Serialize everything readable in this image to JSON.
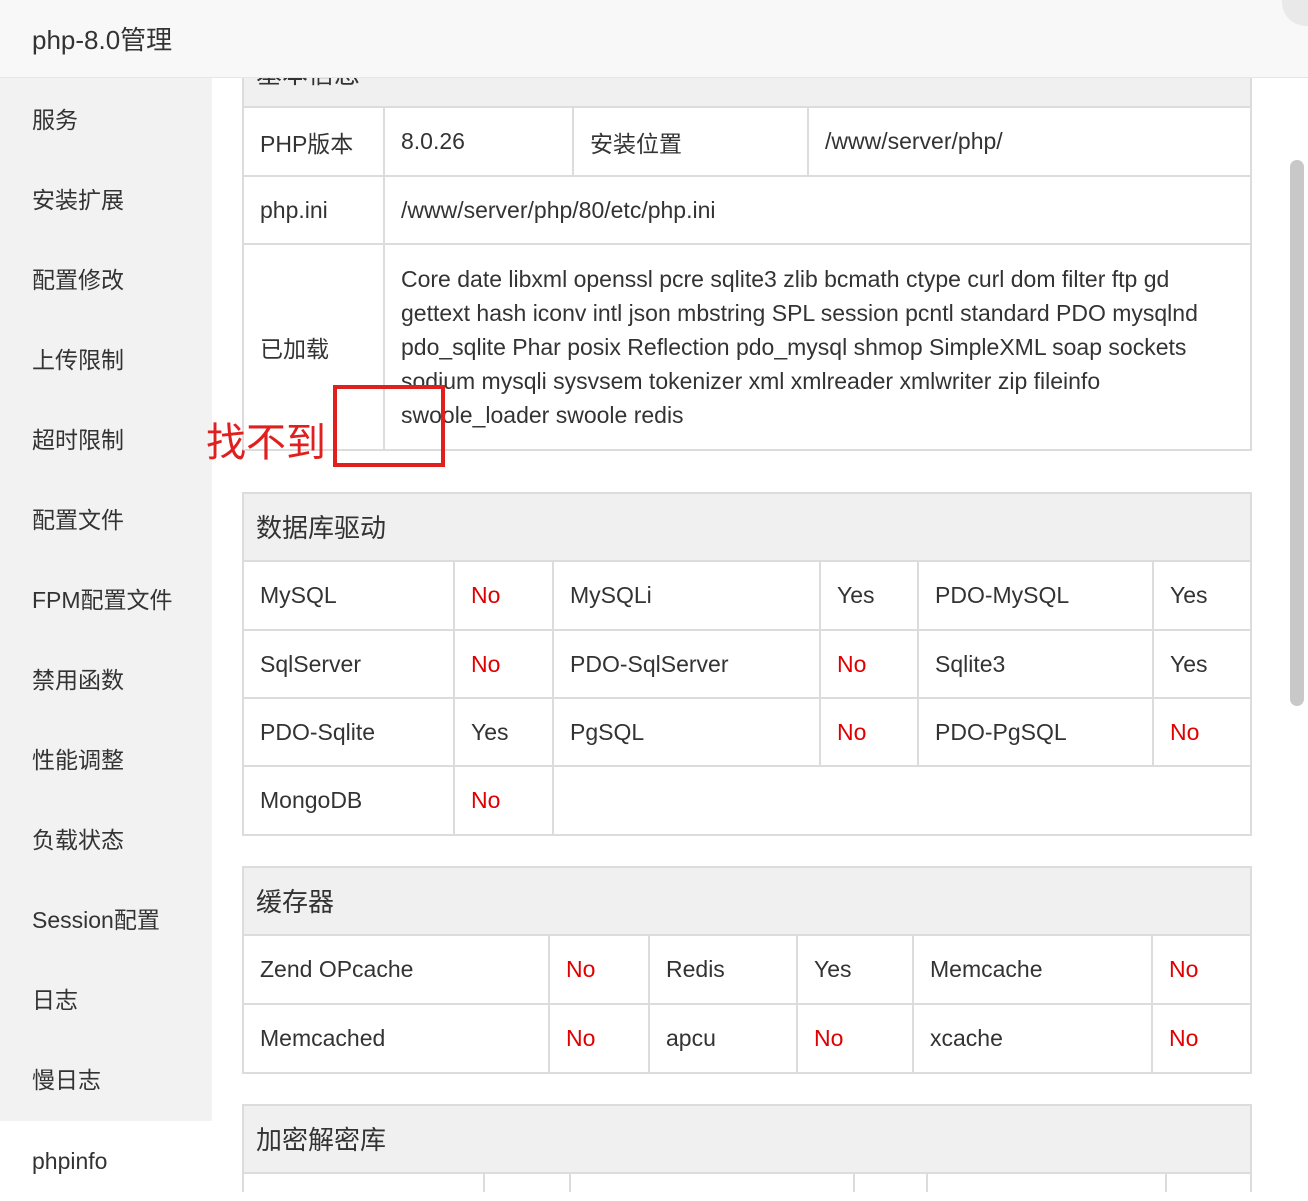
{
  "window": {
    "title": "php-8.0管理"
  },
  "sidebar": {
    "items": [
      {
        "label": "服务"
      },
      {
        "label": "安装扩展"
      },
      {
        "label": "配置修改"
      },
      {
        "label": "上传限制"
      },
      {
        "label": "超时限制"
      },
      {
        "label": "配置文件"
      },
      {
        "label": "FPM配置文件"
      },
      {
        "label": "禁用函数"
      },
      {
        "label": "性能调整"
      },
      {
        "label": "负载状态"
      },
      {
        "label": "Session配置"
      },
      {
        "label": "日志"
      },
      {
        "label": "慢日志"
      },
      {
        "label": "phpinfo"
      }
    ],
    "active": "phpinfo"
  },
  "basic": {
    "heading": "基本信息",
    "php_version_label": "PHP版本",
    "php_version": "8.0.26",
    "install_path_label": "安装位置",
    "install_path": "/www/server/php/",
    "php_ini_label": "php.ini",
    "php_ini": "/www/server/php/80/etc/php.ini",
    "loaded_label": "已加载",
    "loaded": "Core date libxml openssl pcre sqlite3 zlib bcmath ctype curl dom filter ftp gd gettext hash iconv intl json mbstring SPL session pcntl standard PDO mysqlnd pdo_sqlite Phar posix Reflection pdo_mysql shmop SimpleXML soap sockets sodium mysqli sysvsem tokenizer xml xmlreader xmlwriter zip fileinfo swoole_loader swoole redis"
  },
  "db": {
    "heading": "数据库驱动",
    "rows": [
      [
        {
          "name": "MySQL",
          "status": "No"
        },
        {
          "name": "MySQLi",
          "status": "Yes"
        },
        {
          "name": "PDO-MySQL",
          "status": "Yes"
        }
      ],
      [
        {
          "name": "SqlServer",
          "status": "No"
        },
        {
          "name": "PDO-SqlServer",
          "status": "No"
        },
        {
          "name": "Sqlite3",
          "status": "Yes"
        }
      ],
      [
        {
          "name": "PDO-Sqlite",
          "status": "Yes"
        },
        {
          "name": "PgSQL",
          "status": "No"
        },
        {
          "name": "PDO-PgSQL",
          "status": "No"
        }
      ],
      [
        {
          "name": "MongoDB",
          "status": "No"
        }
      ]
    ]
  },
  "cache": {
    "heading": "缓存器",
    "rows": [
      [
        {
          "name": "Zend OPcache",
          "status": "No"
        },
        {
          "name": "Redis",
          "status": "Yes"
        },
        {
          "name": "Memcache",
          "status": "No"
        }
      ],
      [
        {
          "name": "Memcached",
          "status": "No"
        },
        {
          "name": "apcu",
          "status": "No"
        },
        {
          "name": "xcache",
          "status": "No"
        }
      ]
    ]
  },
  "crypto": {
    "heading": "加密解密库"
  },
  "annotation": {
    "text": "找不到"
  },
  "colors": {
    "no": "#e00000",
    "annotation": "#e0201e",
    "sidebar_bg": "#f2f2f2",
    "header_bg": "#f0f0f0"
  }
}
